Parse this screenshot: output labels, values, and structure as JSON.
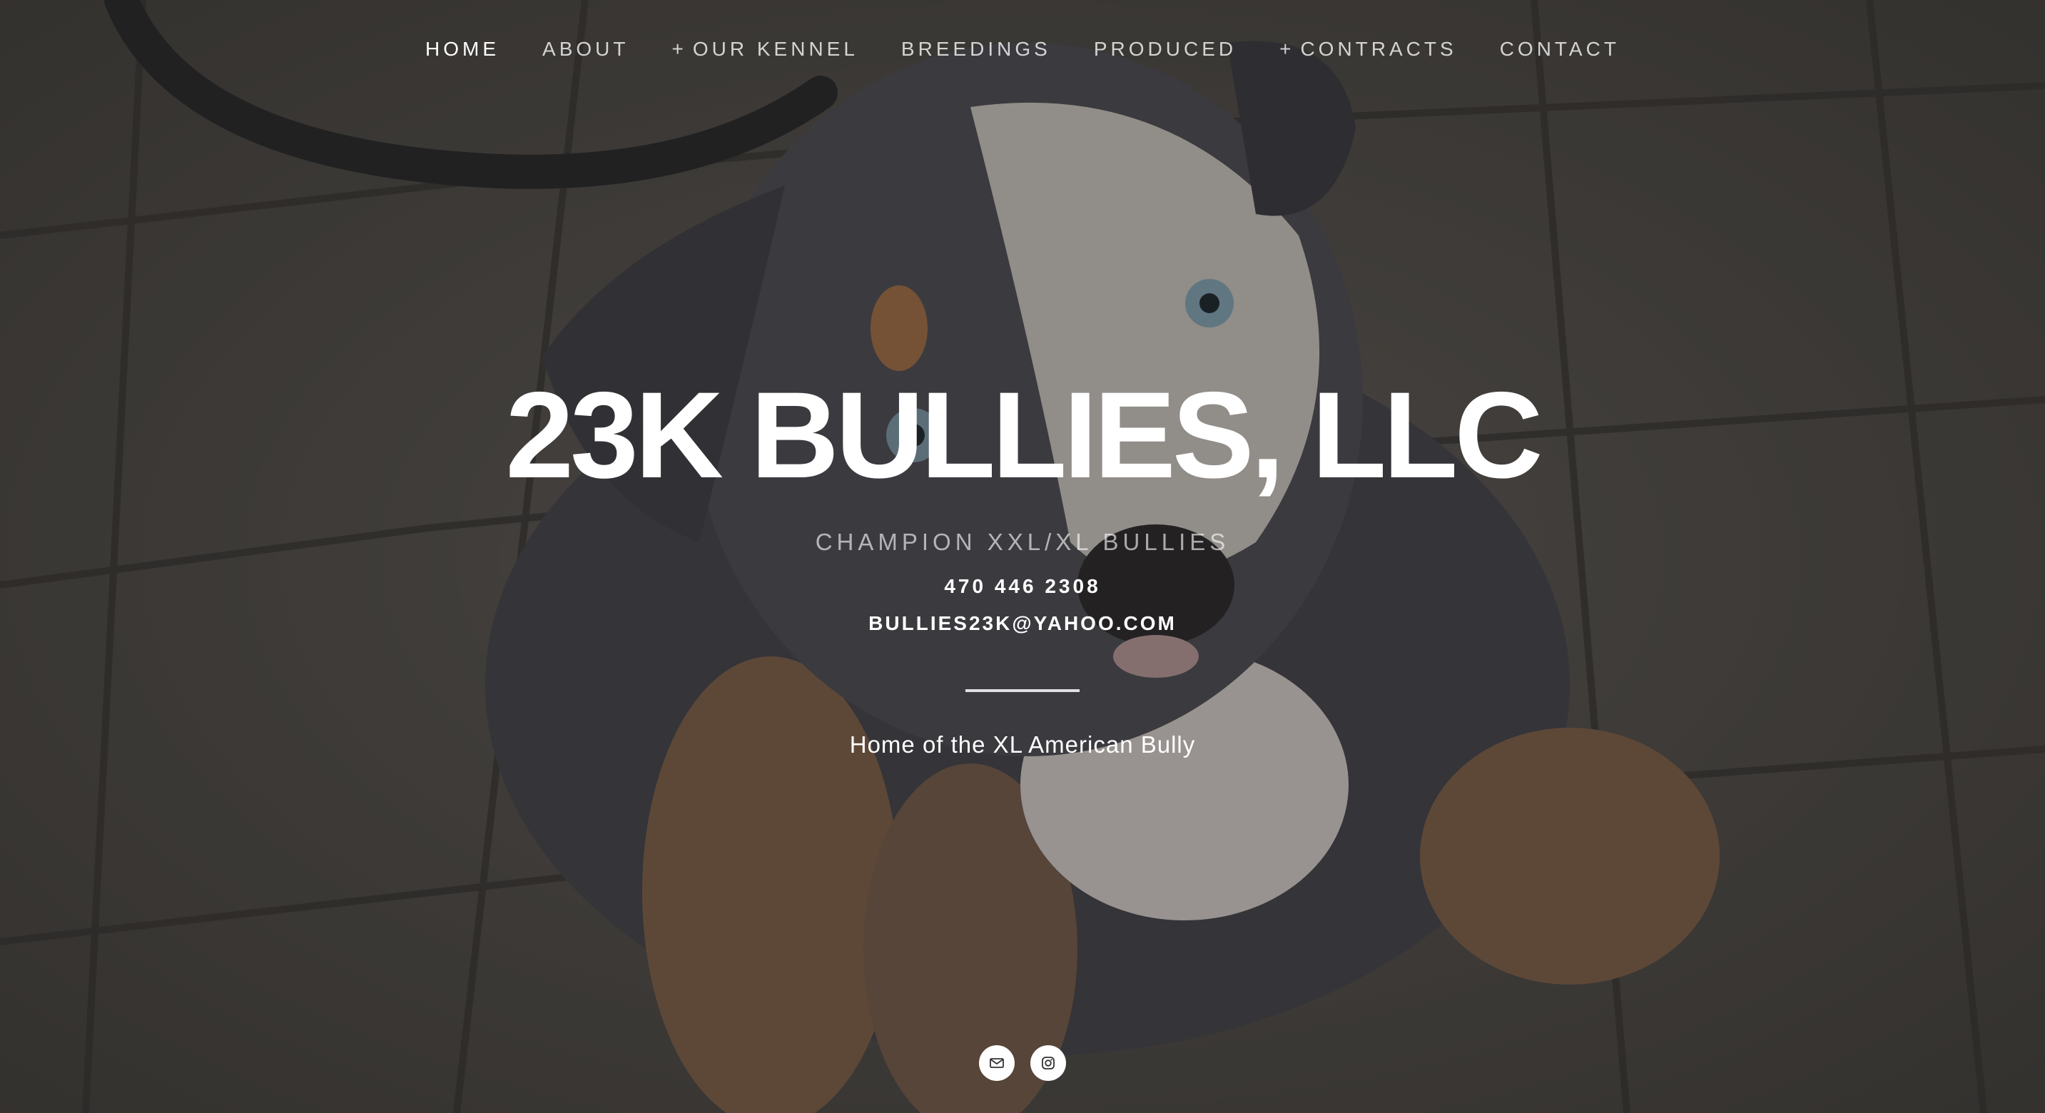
{
  "nav": {
    "items": [
      {
        "label": "HOME",
        "has_submenu": false,
        "active": true
      },
      {
        "label": "ABOUT",
        "has_submenu": false,
        "active": false
      },
      {
        "label": "OUR KENNEL",
        "has_submenu": true,
        "active": false
      },
      {
        "label": "BREEDINGS",
        "has_submenu": false,
        "active": false
      },
      {
        "label": "PRODUCED",
        "has_submenu": false,
        "active": false
      },
      {
        "label": "CONTRACTS",
        "has_submenu": true,
        "active": false
      },
      {
        "label": "CONTACT",
        "has_submenu": false,
        "active": false
      }
    ],
    "submenu_marker": "+"
  },
  "hero": {
    "title": "23K BULLIES, LLC",
    "tagline": "CHAMPION XXL/XL BULLIES",
    "phone": "470 446 2308",
    "email": "BULLIES23K@YAHOO.COM",
    "subtitle": "Home of the XL American Bully"
  },
  "social": {
    "icons": [
      "mail-icon",
      "instagram-icon"
    ]
  },
  "colors": {
    "text": "#ffffff",
    "overlay": "#141210",
    "icon_background": "#ffffff",
    "icon_glyph": "#333333"
  }
}
